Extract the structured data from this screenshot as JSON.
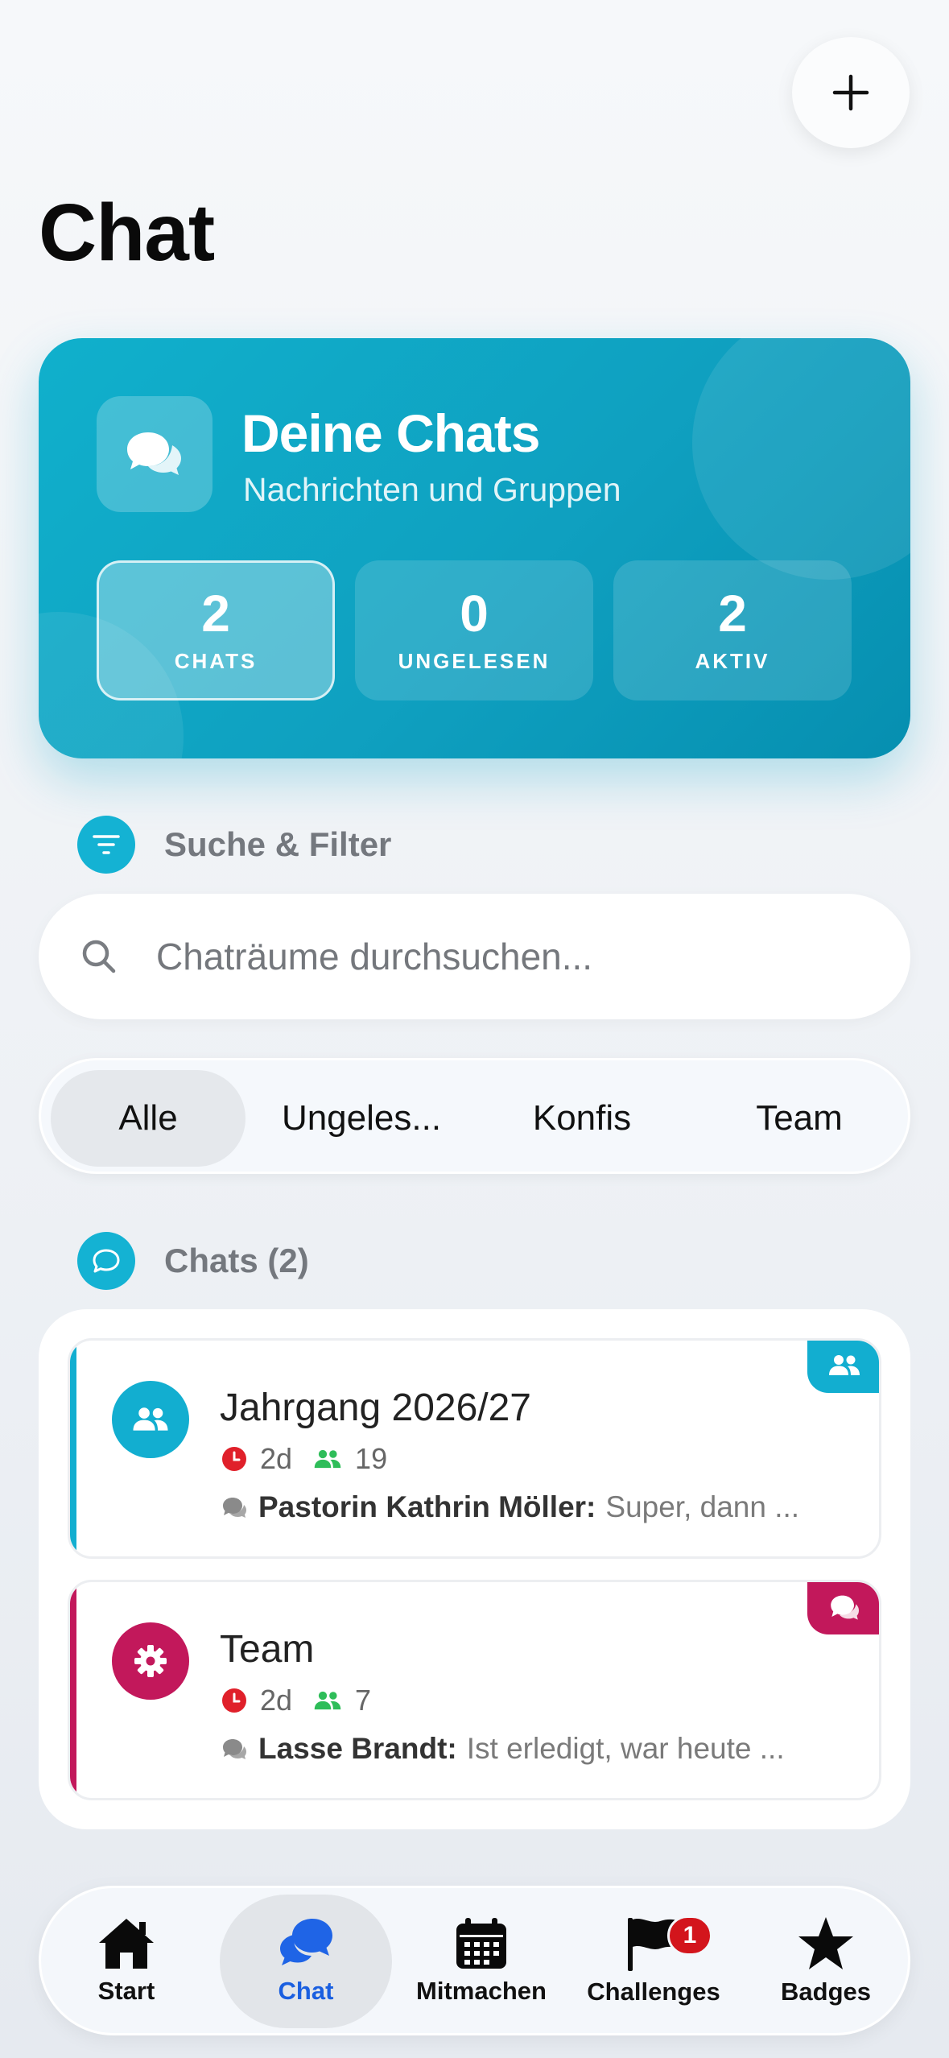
{
  "header": {
    "title": "Chat"
  },
  "hero": {
    "title": "Deine Chats",
    "subtitle": "Nachrichten und Gruppen",
    "stats": [
      {
        "value": "2",
        "label": "CHATS"
      },
      {
        "value": "0",
        "label": "UNGELESEN"
      },
      {
        "value": "2",
        "label": "AKTIV"
      }
    ]
  },
  "filter_section": {
    "label": "Suche & Filter"
  },
  "search": {
    "placeholder": "Chaträume durchsuchen..."
  },
  "segments": {
    "items": [
      "Alle",
      "Ungeles...",
      "Konfis",
      "Team"
    ],
    "selected": "Alle"
  },
  "chats_section": {
    "label": "Chats (2)"
  },
  "chats": [
    {
      "name": "Jahrgang 2026/27",
      "age": "2d",
      "members": "19",
      "sender": "Pastorin Kathrin Möller:",
      "preview": "Super, dann ...",
      "accent": "#12aed0",
      "icon": "people-icon"
    },
    {
      "name": "Team",
      "age": "2d",
      "members": "7",
      "sender": "Lasse Brandt:",
      "preview": "Ist erledigt, war heute ...",
      "accent": "#c2185b",
      "icon": "gear-icon"
    }
  ],
  "tabbar": {
    "items": [
      {
        "label": "Start",
        "icon": "home-icon"
      },
      {
        "label": "Chat",
        "icon": "chat-icon"
      },
      {
        "label": "Mitmachen",
        "icon": "calendar-icon"
      },
      {
        "label": "Challenges",
        "icon": "flag-icon",
        "badge": "1"
      },
      {
        "label": "Badges",
        "icon": "star-icon"
      }
    ],
    "selected": "Chat"
  },
  "colors": {
    "accent_cyan": "#12aed0",
    "accent_magenta": "#c2185b",
    "tab_selected": "#1a5fe0",
    "badge_red": "#d3151c"
  }
}
